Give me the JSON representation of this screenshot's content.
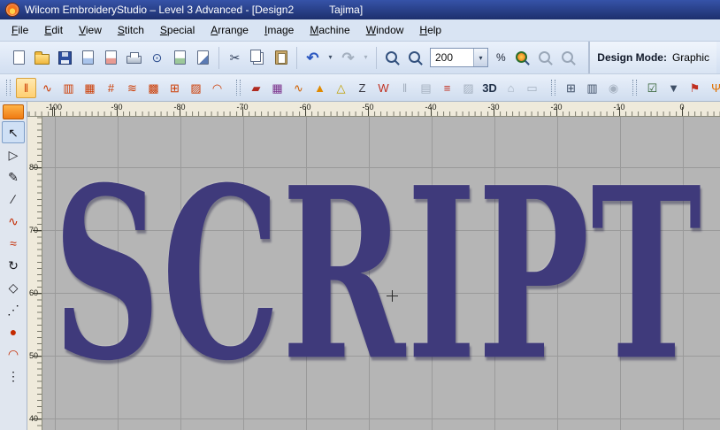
{
  "titlebar": {
    "title": "Wilcom EmbroideryStudio – Level 3 Advanced - [Design2",
    "machine": "Tajima]"
  },
  "menu": {
    "items": [
      {
        "name": "menu-file",
        "label": "File"
      },
      {
        "name": "menu-edit",
        "label": "Edit"
      },
      {
        "name": "menu-view",
        "label": "View"
      },
      {
        "name": "menu-stitch",
        "label": "Stitch"
      },
      {
        "name": "menu-special",
        "label": "Special"
      },
      {
        "name": "menu-arrange",
        "label": "Arrange"
      },
      {
        "name": "menu-image",
        "label": "Image"
      },
      {
        "name": "menu-machine",
        "label": "Machine"
      },
      {
        "name": "menu-window",
        "label": "Window"
      },
      {
        "name": "menu-help",
        "label": "Help"
      }
    ]
  },
  "toolbar_main": {
    "file_icons": [
      {
        "name": "new-design-icon",
        "cls": "shape-page"
      },
      {
        "name": "open-design-icon",
        "cls": "shape-folder"
      },
      {
        "name": "save-design-icon",
        "cls": "shape-floppy"
      },
      {
        "name": "insert-design-icon",
        "cls": "shape-page acc-blue"
      },
      {
        "name": "save-as-icon",
        "cls": "shape-page acc-red"
      },
      {
        "name": "print-icon",
        "cls": "shape-printer"
      },
      {
        "name": "print-preview-icon",
        "glyph": "⊙",
        "color": "#2f4f8f"
      },
      {
        "name": "export-design-icon",
        "cls": "shape-page acc-green"
      },
      {
        "name": "send-to-machine-icon",
        "cls": "shape-page acc-arrow"
      }
    ],
    "clipboard_icons": [
      {
        "name": "cut-icon",
        "glyph": "✂",
        "color": "#33415c"
      },
      {
        "name": "copy-icon",
        "cls": "shape-copy"
      },
      {
        "name": "paste-icon",
        "cls": "shape-paste"
      }
    ],
    "undo_icons": [
      {
        "name": "undo-icon",
        "glyph": "↶",
        "color": "#2b57c0",
        "cls": "big"
      },
      {
        "name": "undo-dropdown-icon",
        "glyph": "▾",
        "cls": "caret"
      },
      {
        "name": "redo-icon",
        "glyph": "↷",
        "cls": "muted big"
      },
      {
        "name": "redo-dropdown-icon",
        "glyph": "▾",
        "cls": "caret muted"
      }
    ],
    "zoom_icons_a": [
      {
        "name": "zoom-tool-icon",
        "cls": "shape-zoom"
      },
      {
        "name": "zoom-1to1-icon",
        "cls": "shape-zoom"
      }
    ],
    "zoom_value": "200",
    "percent_label": "%",
    "zoom_icons_b": [
      {
        "name": "zoom-to-fit-icon",
        "cls": "shape-zoom zfit"
      },
      {
        "name": "zoom-in-icon",
        "cls": "shape-zoom zmut"
      },
      {
        "name": "zoom-out-icon",
        "cls": "shape-zoom zmut"
      }
    ],
    "design_mode_label": "Design Mode:",
    "design_mode_value": "Graphic"
  },
  "toolbar_stitch": {
    "stitch_icons": [
      {
        "name": "satin-stitch-icon",
        "glyph": "‖",
        "color": "#cc3a00",
        "cls": "pressed"
      },
      {
        "name": "run-stitch-icon",
        "glyph": "∿",
        "color": "#cc3a00"
      },
      {
        "name": "tatami-fill-icon",
        "glyph": "▥",
        "color": "#cc3a00"
      },
      {
        "name": "motif-fill-icon",
        "glyph": "▦",
        "color": "#cc3a00"
      },
      {
        "name": "cross-stitch-icon",
        "glyph": "#",
        "color": "#cc3a00"
      },
      {
        "name": "wave-fill-icon",
        "glyph": "≋",
        "color": "#cc3a00"
      },
      {
        "name": "pattern-fill-icon",
        "glyph": "▩",
        "color": "#cc3a00"
      },
      {
        "name": "applique-icon",
        "glyph": "⊞",
        "color": "#cc3a00"
      },
      {
        "name": "contour-fill-icon",
        "glyph": "▨",
        "color": "#cc3a00"
      },
      {
        "name": "arc-stitch-icon",
        "glyph": "◠",
        "color": "#cc3a00"
      }
    ],
    "effect_icons": [
      {
        "name": "underlay-icon",
        "glyph": "▰",
        "color": "#b02a20"
      },
      {
        "name": "density-icon",
        "glyph": "▦",
        "color": "#7a2f8a"
      },
      {
        "name": "zigzag-effect-icon",
        "glyph": "∿",
        "color": "#d06000"
      },
      {
        "name": "textured-edge-icon",
        "glyph": "▲",
        "color": "#e08a00"
      },
      {
        "name": "overlap-warning-icon",
        "glyph": "△",
        "color": "#c0a000"
      },
      {
        "name": "smooth-curves-icon",
        "glyph": "Z",
        "color": "#3a3a44"
      },
      {
        "name": "stitch-angle-icon",
        "glyph": "W",
        "color": "#c03020"
      },
      {
        "name": "travel-run-icon",
        "glyph": "‖",
        "cls": "muted"
      },
      {
        "name": "jump-stitch-icon",
        "glyph": "▤",
        "cls": "muted"
      },
      {
        "name": "color-blend-icon",
        "glyph": "≡",
        "color": "#c03020"
      },
      {
        "name": "carving-stamp-icon",
        "glyph": "▨",
        "cls": "muted"
      },
      {
        "name": "view-3d-icon",
        "glyph": "3D",
        "cls": "threed"
      },
      {
        "name": "morph-effect-icon",
        "glyph": "⌂",
        "cls": "muted"
      },
      {
        "name": "outline-box-icon",
        "glyph": "▭",
        "cls": "muted"
      }
    ],
    "view_icons": [
      {
        "name": "show-grid-icon",
        "glyph": "⊞",
        "color": "#3f4f66"
      },
      {
        "name": "show-rulers-icon",
        "glyph": "▥",
        "color": "#3f4f66"
      },
      {
        "name": "snap-to-grid-icon",
        "glyph": "◉",
        "cls": "muted"
      }
    ],
    "docker_icons": [
      {
        "name": "object-properties-icon",
        "glyph": "☑",
        "color": "#2a5a2a"
      },
      {
        "name": "filter-objects-icon",
        "glyph": "▼",
        "color": "#3f4f66"
      },
      {
        "name": "color-film-icon",
        "glyph": "⚑",
        "color": "#c03020"
      },
      {
        "name": "branching-icon",
        "glyph": "Ψ",
        "color": "#e07000"
      }
    ]
  },
  "toolbox": {
    "tools": [
      {
        "name": "select-object-tool",
        "glyph": "↖",
        "cls": "sel"
      },
      {
        "name": "reshape-object-tool",
        "glyph": "▷"
      },
      {
        "name": "lettering-tool",
        "glyph": "✎"
      },
      {
        "name": "knife-tool",
        "glyph": "∕"
      },
      {
        "name": "freehand-stitch-tool",
        "glyph": "∿",
        "cls": "red"
      },
      {
        "name": "wave-stitch-tool",
        "glyph": "≈",
        "cls": "red"
      },
      {
        "name": "rotate-tool",
        "glyph": "↻"
      },
      {
        "name": "polygon-tool",
        "glyph": "◇"
      },
      {
        "name": "node-edit-tool",
        "glyph": "⋰"
      },
      {
        "name": "circle-tool",
        "glyph": "●",
        "cls": "red"
      },
      {
        "name": "arch-tool",
        "glyph": "◠",
        "cls": "red"
      },
      {
        "name": "more-tools",
        "glyph": "⋮"
      }
    ]
  },
  "ruler": {
    "h_labels": [
      {
        "label": "-100"
      },
      {
        "label": "-90"
      },
      {
        "label": "-80"
      },
      {
        "label": "-70"
      },
      {
        "label": "-60"
      },
      {
        "label": "-50"
      },
      {
        "label": "-40"
      },
      {
        "label": "-30"
      },
      {
        "label": "-20"
      },
      {
        "label": "-10"
      },
      {
        "label": "0"
      }
    ],
    "v_labels": [
      {
        "label": "80"
      },
      {
        "label": "70"
      },
      {
        "label": "60"
      },
      {
        "label": "50"
      },
      {
        "label": "40"
      }
    ]
  },
  "canvas": {
    "design_text": "SCRIPT"
  },
  "colors": {
    "titlebar_start": "#3653a8",
    "titlebar_end": "#1d2f6d",
    "chrome": "#d9e4f3",
    "canvas_bg": "#b5b5b5",
    "grid_line": "#9a9a9a",
    "thread": "#3f3a7b",
    "ruler_bg": "#efeadb",
    "icon_orange": "#cc3a00",
    "palette_handle": "#f07a12"
  }
}
